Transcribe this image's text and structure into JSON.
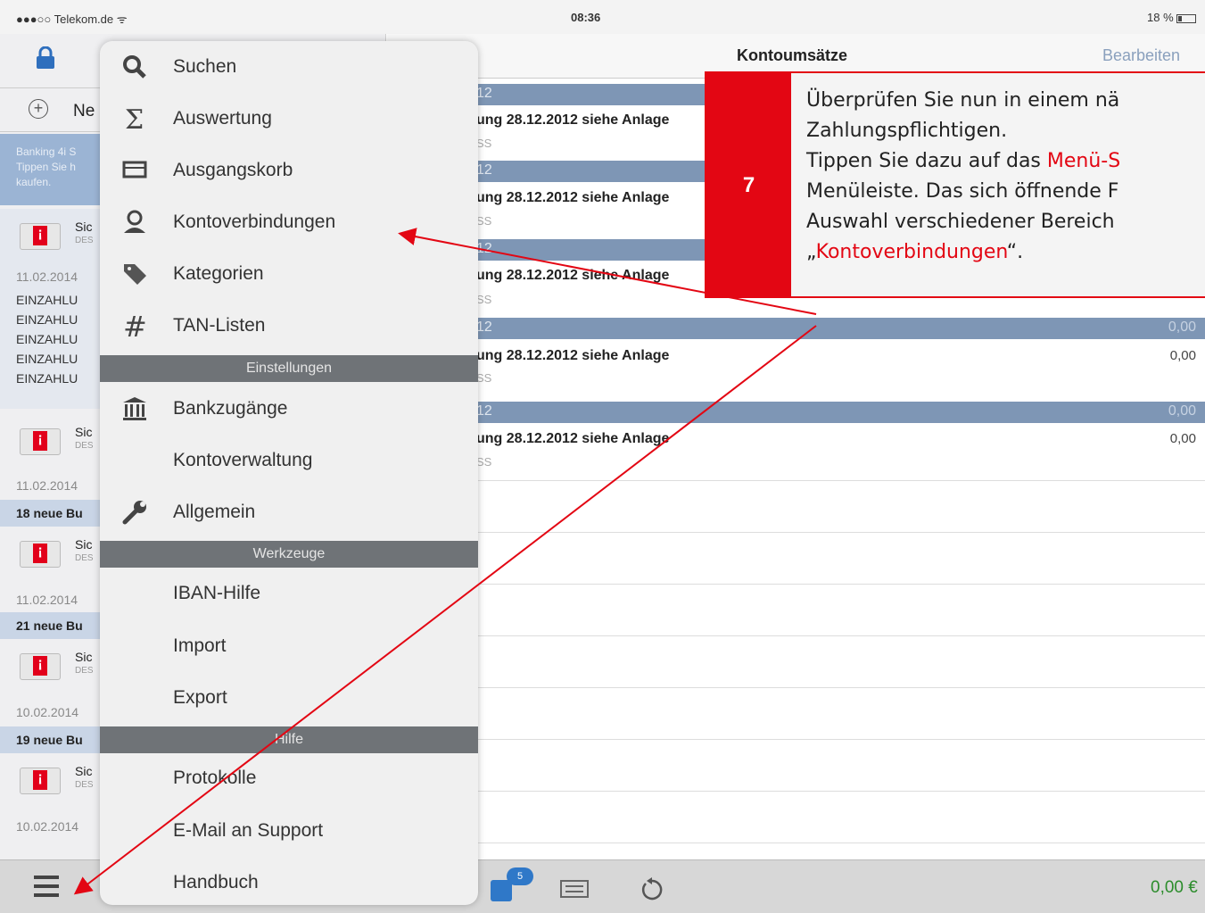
{
  "status": {
    "carrier": "●●●○○ Telekom.de ᯤ",
    "time": "08:36",
    "battery": "18 %"
  },
  "left": {
    "new_label": "Ne",
    "banner": [
      "Banking 4i S",
      "Tippen Sie h",
      "kaufen."
    ],
    "accounts": [
      {
        "name": "Sic",
        "sub": "DES",
        "date": "11.02.2014",
        "lines": [
          "EINZAHLU",
          "EINZAHLU",
          "EINZAHLU",
          "EINZAHLU",
          "EINZAHLU"
        ]
      },
      {
        "name": "Sic",
        "sub": "DES",
        "date": "11.02.2014",
        "summary": "18 neue Bu"
      },
      {
        "name": "Sic",
        "sub": "DES",
        "date": "11.02.2014",
        "summary": "21 neue Bu"
      },
      {
        "name": "Sic",
        "sub": "DES",
        "date": "10.02.2014",
        "summary": "19 neue Bu"
      },
      {
        "name": "Sic",
        "sub": "DES",
        "date": "10.02.2014"
      }
    ]
  },
  "header": {
    "title": "Kontoumsätze",
    "edit": "Bearbeiten"
  },
  "transactions": [
    {
      "section": "12",
      "amount": "",
      "text": "ung 28.12.2012 siehe Anlage",
      "sub": "SS",
      "value": ""
    },
    {
      "section": "12",
      "amount": "",
      "text": "ung 28.12.2012 siehe Anlage",
      "sub": "SS",
      "value": ""
    },
    {
      "section": "12",
      "amount": "",
      "text": "ung 28.12.2012 siehe Anlage",
      "sub": "SS",
      "value": ""
    },
    {
      "section": "12",
      "amount": "0,00",
      "text": "ung 28.12.2012 siehe Anlage",
      "sub": "SS",
      "value": "0,00"
    },
    {
      "section": "12",
      "amount": "0,00",
      "text": "ung 28.12.2012 siehe Anlage",
      "sub": "SS",
      "value": "0,00"
    }
  ],
  "menu": {
    "items": [
      {
        "label": "Suchen",
        "icon": "search-icon"
      },
      {
        "label": "Auswertung",
        "icon": "sigma-icon"
      },
      {
        "label": "Ausgangskorb",
        "icon": "tray-icon"
      },
      {
        "label": "Kontoverbindungen",
        "icon": "contact-icon"
      },
      {
        "label": "Kategorien",
        "icon": "tag-icon"
      },
      {
        "label": "TAN-Listen",
        "icon": "hash-icon"
      }
    ],
    "header_settings": "Einstellungen",
    "settings": [
      {
        "label": "Bankzugänge",
        "icon": "bank-icon"
      },
      {
        "label": "Kontoverwaltung",
        "icon": ""
      },
      {
        "label": "Allgemein",
        "icon": "wrench-icon"
      }
    ],
    "header_tools": "Werkzeuge",
    "tools": [
      {
        "label": "IBAN-Hilfe"
      },
      {
        "label": "Import"
      },
      {
        "label": "Export"
      }
    ],
    "header_help": "Hilfe",
    "help": [
      {
        "label": "Protokolle"
      },
      {
        "label": "E-Mail an Support"
      },
      {
        "label": "Handbuch"
      }
    ]
  },
  "toolbar": {
    "badge": "5",
    "total": "0,00 €"
  },
  "callout": {
    "number": "7",
    "line1": "Überprüfen Sie nun in einem nä",
    "line2": "Zahlungspflichtigen.",
    "line3_pre": "Tippen Sie dazu auf das ",
    "line3_hl": "Menü-S",
    "line4": "Menüleiste. Das sich öffnende F",
    "line5": "Auswahl verschiedener Bereich",
    "line6_pre": "„",
    "line6_hl": "Kontoverbindungen",
    "line6_post": "“."
  },
  "colors": {
    "accent": "#e30613",
    "section": "#7e96b5",
    "menu_header": "#6f7377"
  }
}
